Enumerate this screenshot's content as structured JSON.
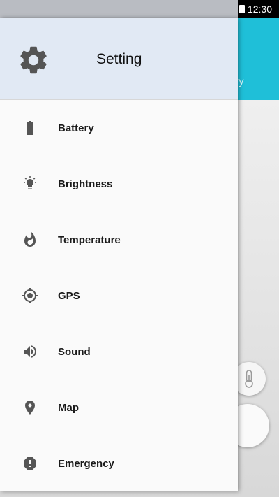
{
  "status_bar": {
    "time": "12:30",
    "icons": [
      "battery-icon"
    ]
  },
  "background_app": {
    "toolbar_color": "#1fbfd8",
    "tab_label_partial": "ery",
    "fab_icons": [
      "thermometer-icon"
    ]
  },
  "drawer": {
    "header": {
      "title": "Setting",
      "icon": "gear-icon",
      "background": "#e1e9f4"
    },
    "items": [
      {
        "label": "Battery",
        "icon": "battery-icon"
      },
      {
        "label": "Brightness",
        "icon": "lightbulb-icon"
      },
      {
        "label": "Temperature",
        "icon": "flame-icon"
      },
      {
        "label": "GPS",
        "icon": "gps-crosshair-icon"
      },
      {
        "label": "Sound",
        "icon": "volume-icon"
      },
      {
        "label": "Map",
        "icon": "map-pin-icon"
      },
      {
        "label": "Emergency",
        "icon": "alert-octagon-icon"
      }
    ]
  }
}
